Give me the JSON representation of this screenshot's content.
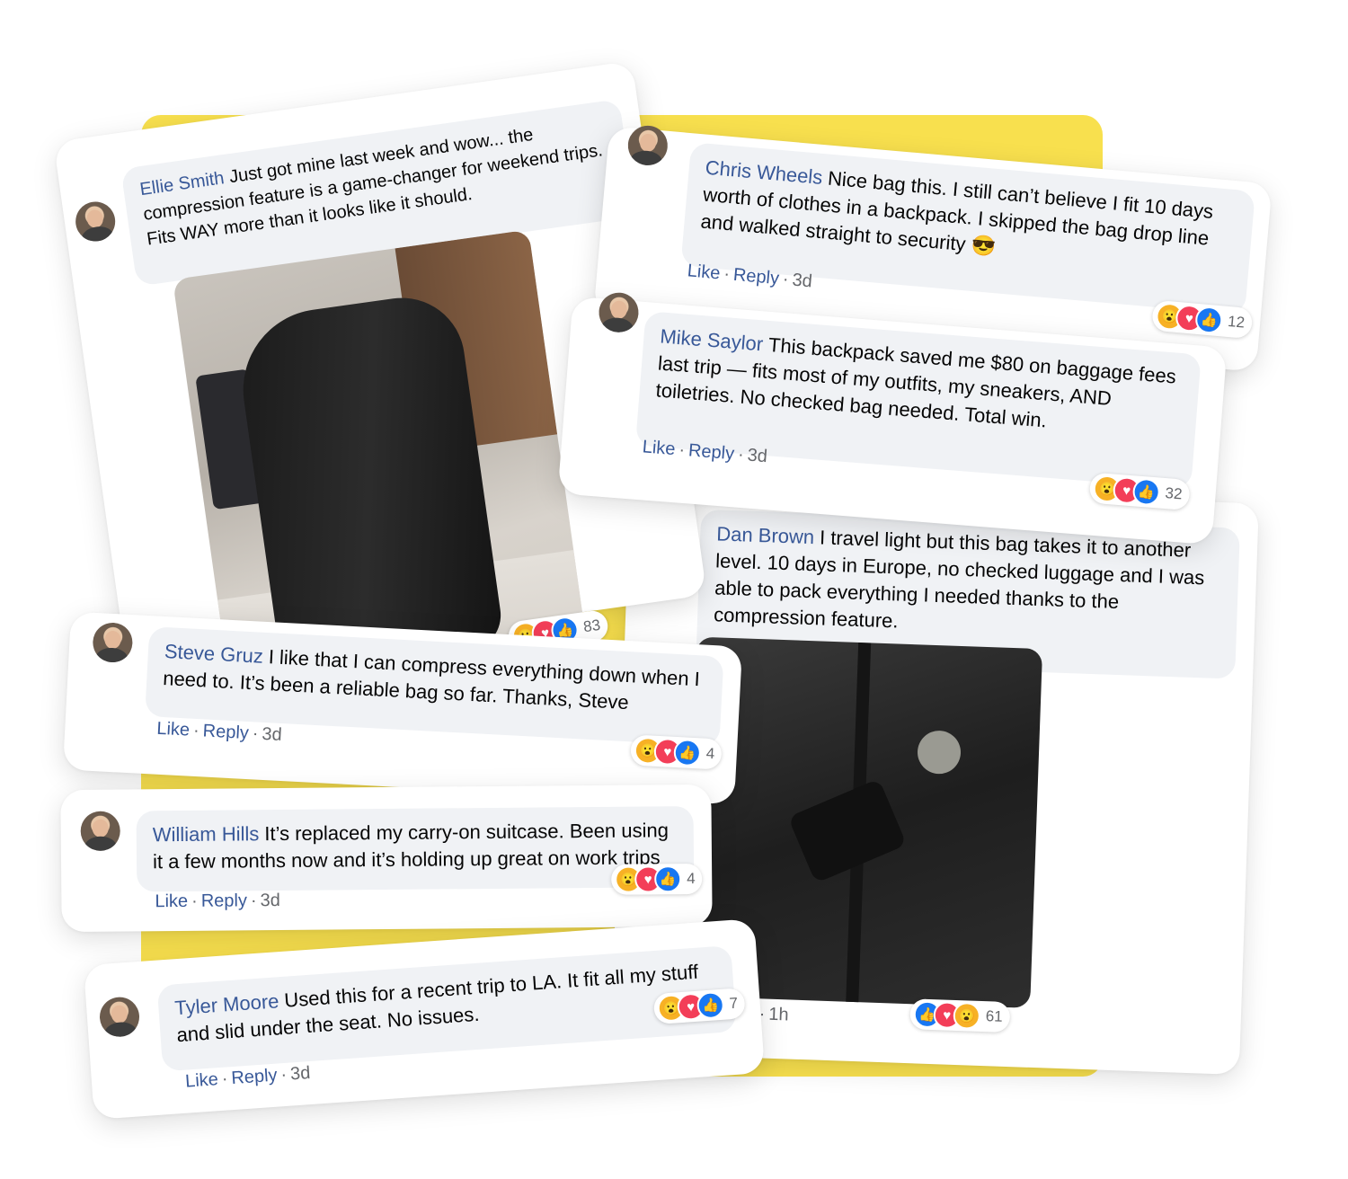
{
  "comments": [
    {
      "name": "Ellie Smith",
      "text": "Just got mine last week and wow... the compression feature is a game-changer for weekend trips. Fits WAY more than it looks like it should.",
      "reaction_count": "83",
      "photo": "backpack-photo"
    },
    {
      "name": "Chris Wheels",
      "text": "Nice bag this. I still can’t believe I fit 10 days worth of clothes in a backpack. I skipped the bag drop line and walked straight to security 😎",
      "like": "Like",
      "reply": "Reply",
      "time": "3d",
      "reaction_count": "12"
    },
    {
      "name": "Mike Saylor",
      "text": "This backpack saved me $80 on baggage fees last trip — fits most of my outfits, my sneakers, AND toiletries. No checked bag needed. Total win.",
      "like": "Like",
      "reply": "Reply",
      "time": "3d",
      "reaction_count": "32"
    },
    {
      "name": "Dan Brown",
      "text": "I travel light but this bag takes it to another level. 10 days in Europe, no checked luggage and I was able to pack everything I needed thanks to the compression feature.",
      "time_partial": "y",
      "time": "1h",
      "reaction_count": "61",
      "photo": "packed-bag-photo"
    },
    {
      "name": "Steve Gruz",
      "text": "I like that I can compress everything down when I need to. It’s been a reliable bag so far. Thanks, Steve",
      "like": "Like",
      "reply": "Reply",
      "time": "3d",
      "reaction_count": "4"
    },
    {
      "name": "William Hills",
      "text": "It’s replaced my carry-on suitcase. Been using it a few months now and it’s holding up great on work trips",
      "like": "Like",
      "reply": "Reply",
      "time": "3d",
      "reaction_count": "4"
    },
    {
      "name": "Tyler Moore",
      "text": "Used this for a recent trip to LA. It fit all my stuff and slid under the seat. No issues.",
      "like": "Like",
      "reply": "Reply",
      "time": "3d",
      "reaction_count": "7"
    }
  ],
  "colors": {
    "accent_yellow": "#f8e04e",
    "name_blue": "#385898",
    "bubble_gray": "#f0f2f5"
  },
  "icons": [
    "wow-reaction-icon",
    "love-reaction-icon",
    "like-reaction-icon"
  ]
}
